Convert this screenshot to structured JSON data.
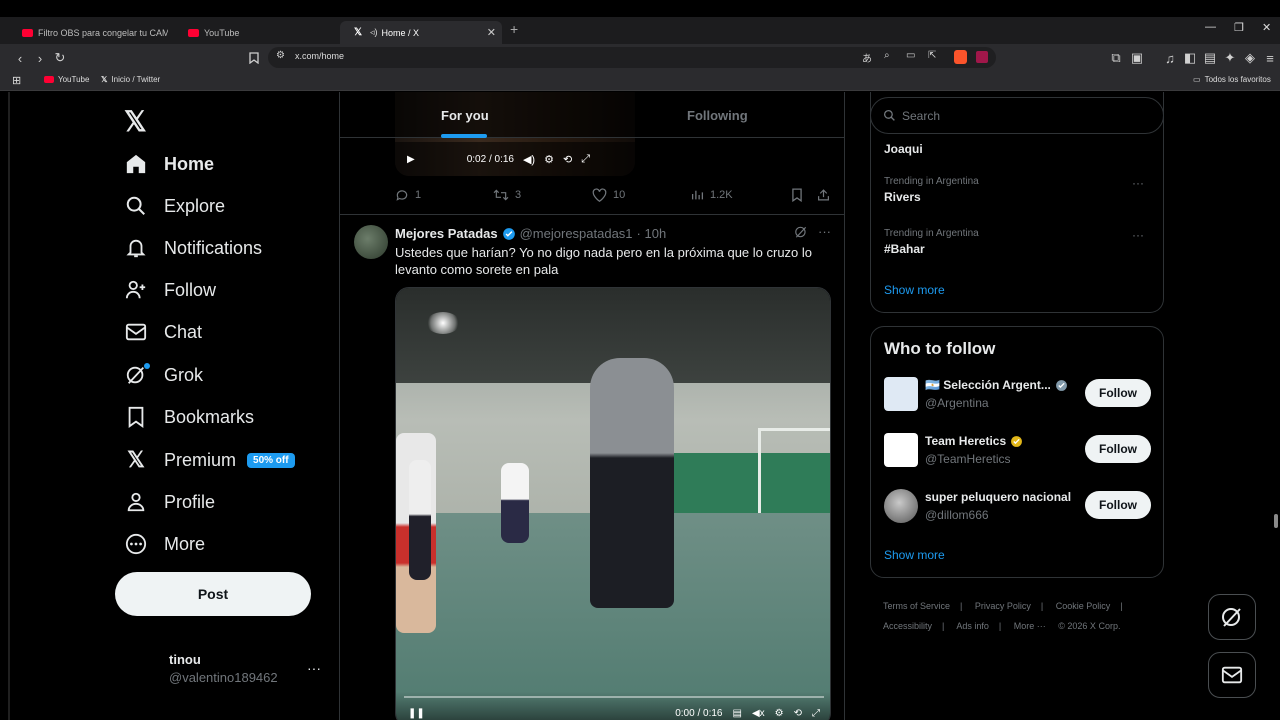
{
  "browser": {
    "tabs": [
      {
        "title": "Filtro OBS para congelar tu CAM en ..."
      },
      {
        "title": "YouTube"
      },
      {
        "title": "Home / X"
      }
    ],
    "url": "x.com/home",
    "bookmarks": [
      {
        "label": "YouTube"
      },
      {
        "label": "Inicio / Twitter"
      }
    ],
    "bookmarks_right": "Todos los favoritos"
  },
  "nav": {
    "items": [
      {
        "label": "Home",
        "icon": "home-icon"
      },
      {
        "label": "Explore",
        "icon": "search-icon"
      },
      {
        "label": "Notifications",
        "icon": "bell-icon"
      },
      {
        "label": "Follow",
        "icon": "add-person-icon"
      },
      {
        "label": "Chat",
        "icon": "mail-icon"
      },
      {
        "label": "Grok",
        "icon": "grok-icon"
      },
      {
        "label": "Bookmarks",
        "icon": "bookmark-icon"
      },
      {
        "label": "Premium",
        "icon": "x-logo-icon"
      },
      {
        "label": "Profile",
        "icon": "person-icon"
      },
      {
        "label": "More",
        "icon": "more-circle-icon"
      }
    ],
    "premium_badge": "50% off",
    "post_label": "Post",
    "account": {
      "name": "tinou",
      "handle": "@valentino189462"
    }
  },
  "timeline": {
    "tabs": [
      "For you",
      "Following"
    ],
    "prev_tweet": {
      "video_time": "0:02 / 0:16",
      "replies": "1",
      "reposts": "3",
      "likes": "10",
      "views": "1.2K"
    },
    "tweet": {
      "name": "Mejores Patadas",
      "handle": "@mejorespatadas1",
      "time": "· 10h",
      "text": "Ustedes que harían? Yo no digo nada pero en la próxima que lo cruzo lo levanto como sorete en pala",
      "video_time": "0:00 / 0:16",
      "progress": 0
    }
  },
  "sidebar": {
    "search_placeholder": "Search",
    "trends": [
      {
        "context": "",
        "title": "Joaqui"
      },
      {
        "context": "Trending in Argentina",
        "title": "Rivers"
      },
      {
        "context": "Trending in Argentina",
        "title": "#Bahar"
      }
    ],
    "show_more": "Show more",
    "who_to_follow": {
      "title": "Who to follow",
      "people": [
        {
          "name": "🇦🇷 Selección Argent...",
          "handle": "@Argentina",
          "badge": "blue"
        },
        {
          "name": "Team Heretics",
          "handle": "@TeamHeretics",
          "badge": "gold"
        },
        {
          "name": "super peluquero nacional",
          "handle": "@dillom666",
          "badge": ""
        }
      ],
      "follow_label": "Follow",
      "show_more": "Show more"
    },
    "footer": [
      "Terms of Service",
      "|",
      "Privacy Policy",
      "|",
      "Cookie Policy",
      "|",
      "Accessibility",
      "|",
      "Ads info",
      "|",
      "More ···",
      "© 2026 X Corp."
    ]
  },
  "colors": {
    "accent": "#1d9bf0",
    "bg": "#000000",
    "border": "#2f3336",
    "muted": "#71767b"
  }
}
